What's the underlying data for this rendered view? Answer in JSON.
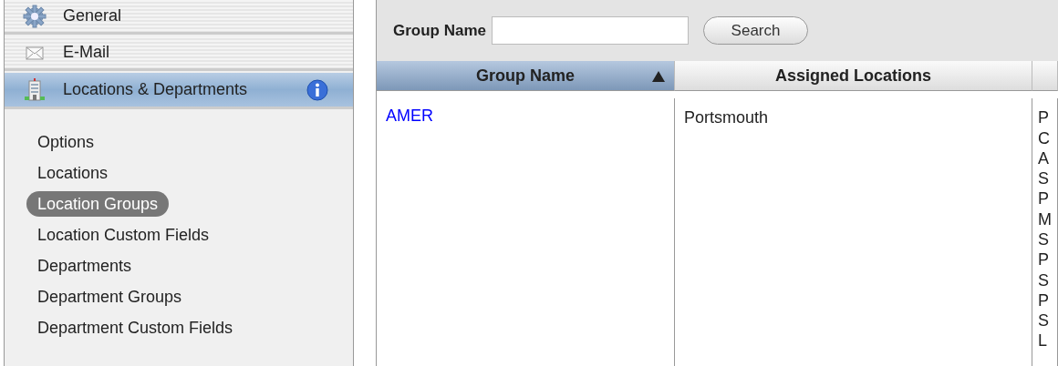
{
  "sidebar": {
    "sections": [
      {
        "label": "General",
        "kind": "gear",
        "selected": false,
        "info": false
      },
      {
        "label": "E-Mail",
        "kind": "mail",
        "selected": false,
        "info": false
      },
      {
        "label": "Locations & Departments",
        "kind": "building",
        "selected": true,
        "info": true
      }
    ],
    "items": [
      {
        "label": "Options",
        "selected": false
      },
      {
        "label": "Locations",
        "selected": false
      },
      {
        "label": "Location Groups",
        "selected": true
      },
      {
        "label": "Location Custom Fields",
        "selected": false
      },
      {
        "label": "Departments",
        "selected": false
      },
      {
        "label": "Department Groups",
        "selected": false
      },
      {
        "label": "Department Custom Fields",
        "selected": false
      }
    ]
  },
  "search": {
    "label": "Group Name",
    "button": "Search"
  },
  "table": {
    "columns": [
      {
        "label": "Group Name",
        "sorted": true
      },
      {
        "label": "Assigned Locations",
        "sorted": false
      },
      {
        "sorted": false
      }
    ],
    "rows": [
      {
        "group_name": "AMER",
        "assigned_locations": [
          "Portsmouth"
        ],
        "column_3": [
          "P",
          "C",
          "A",
          "S",
          "P",
          "M",
          "S",
          "P",
          "S",
          "P",
          "S",
          "L"
        ]
      }
    ]
  }
}
